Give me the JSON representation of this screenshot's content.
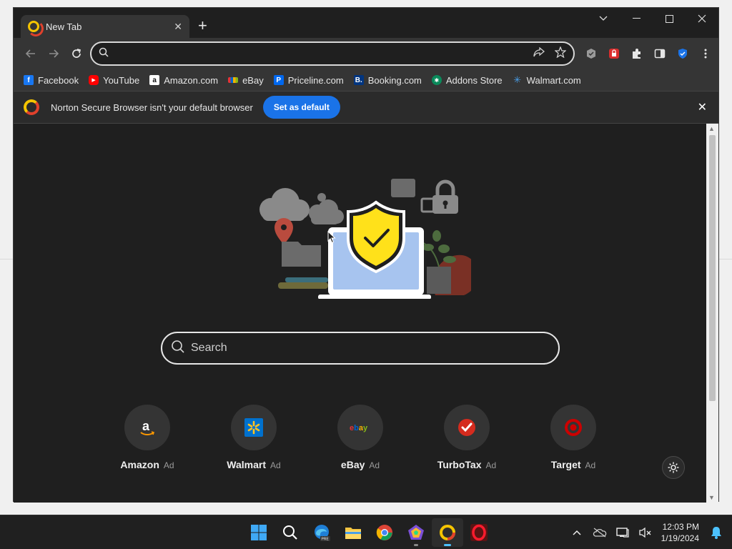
{
  "browser": {
    "tab": {
      "title": "New Tab"
    },
    "omnibox": {
      "value": "",
      "placeholder": ""
    },
    "bookmarks": [
      {
        "label": "Facebook",
        "icon": "facebook-icon",
        "color": "#1877f2"
      },
      {
        "label": "YouTube",
        "icon": "youtube-icon",
        "color": "#ff0000"
      },
      {
        "label": "Amazon.com",
        "icon": "amazon-icon",
        "color": "#ffffff"
      },
      {
        "label": "eBay",
        "icon": "ebay-icon",
        "color": "#e53238"
      },
      {
        "label": "Priceline.com",
        "icon": "priceline-icon",
        "color": "#0068ef"
      },
      {
        "label": "Booking.com",
        "icon": "booking-icon",
        "color": "#003580"
      },
      {
        "label": "Addons Store",
        "icon": "addons-store-icon",
        "color": "#0a8a5b"
      },
      {
        "label": "Walmart.com",
        "icon": "walmart-icon",
        "color": "#0071ce"
      }
    ]
  },
  "infobar": {
    "message": "Norton Secure Browser isn't your default browser",
    "button_label": "Set as default"
  },
  "newtab": {
    "search_placeholder": "Search",
    "tiles": [
      {
        "label": "Amazon",
        "ad": "Ad",
        "icon": "amazon-logo-icon"
      },
      {
        "label": "Walmart",
        "ad": "Ad",
        "icon": "walmart-logo-icon"
      },
      {
        "label": "eBay",
        "ad": "Ad",
        "icon": "ebay-logo-icon"
      },
      {
        "label": "TurboTax",
        "ad": "Ad",
        "icon": "turbotax-logo-icon"
      },
      {
        "label": "Target",
        "ad": "Ad",
        "icon": "target-logo-icon"
      }
    ]
  },
  "taskbar": {
    "time": "12:03 PM",
    "date": "1/19/2024"
  },
  "colors": {
    "accent": "#1a73e8",
    "shield_yellow": "#ffe11a",
    "taskbar_indicator": "#4cc2ff"
  }
}
